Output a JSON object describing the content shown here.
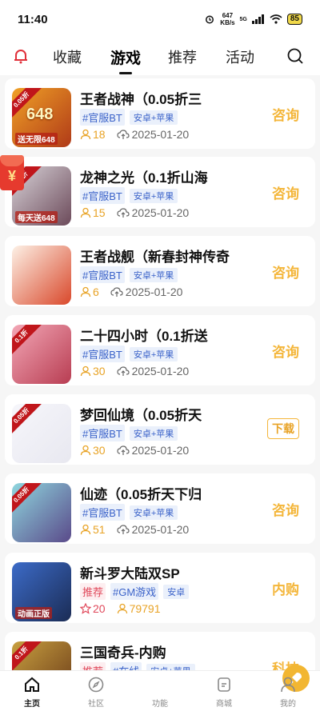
{
  "status": {
    "time": "11:40",
    "speed_top": "647",
    "speed_bottom": "KB/s",
    "net": "5G",
    "battery": "85"
  },
  "nav": {
    "tabs": [
      "收藏",
      "游戏",
      "推荐",
      "活动"
    ],
    "active": "游戏"
  },
  "games": [
    {
      "title": "王者战神（0.05折三",
      "tag": "#官服BT",
      "platform": "安卓+苹果",
      "count": "18",
      "date": "2025-01-20",
      "action": "咨询",
      "ribbon": "0.05折",
      "art": "648",
      "art_sub": "送无限648",
      "colors": [
        "#f0a126",
        "#b03a18"
      ]
    },
    {
      "title": "龙神之光（0.1折山海",
      "tag": "#官服BT",
      "platform": "安卓+苹果",
      "count": "15",
      "date": "2025-01-20",
      "action": "咨询",
      "ribbon": "0.1折",
      "art": "",
      "art_sub": "每天送648",
      "colors": [
        "#d9d4d9",
        "#6c4a5a"
      ]
    },
    {
      "title": "王者战舰（新春封神传奇",
      "tag": "#官服BT",
      "platform": "安卓+苹果",
      "count": "6",
      "date": "2025-01-20",
      "action": "咨询",
      "ribbon": "",
      "art": "",
      "art_sub": "",
      "colors": [
        "#fdf1e6",
        "#d9482b"
      ]
    },
    {
      "title": "二十四小时（0.1折送",
      "tag": "#官服BT",
      "platform": "安卓+苹果",
      "count": "30",
      "date": "2025-01-20",
      "action": "咨询",
      "ribbon": "0.1折",
      "art": "",
      "art_sub": "",
      "colors": [
        "#f3a7b6",
        "#b83d52"
      ]
    },
    {
      "title": "梦回仙境（0.05折天",
      "tag": "#官服BT",
      "platform": "安卓+苹果",
      "count": "30",
      "date": "2025-01-20",
      "action": "下载",
      "ribbon": "0.05折",
      "art": "",
      "art_sub": "",
      "colors": [
        "#f6f6fb",
        "#e8e8f0"
      ]
    },
    {
      "title": "仙迹（0.05折天下归",
      "tag": "#官服BT",
      "platform": "安卓+苹果",
      "count": "51",
      "date": "2025-01-20",
      "action": "咨询",
      "ribbon": "0.05折",
      "art": "",
      "art_sub": "",
      "colors": [
        "#8fd6de",
        "#5a4a8a"
      ]
    },
    {
      "title": "新斗罗大陆双SP",
      "tag_red": "推荐",
      "tag": "#GM游戏",
      "platform": "安卓",
      "stars": "20",
      "count": "79791",
      "action": "内购",
      "ribbon": "",
      "art": "",
      "art_sub": "动画正版",
      "colors": [
        "#3c6bc8",
        "#1b2c55"
      ]
    },
    {
      "title": "三国奇兵-内购",
      "tag_red": "推荐",
      "tag": "#在线",
      "platform": "安卓+苹果",
      "action": "科技",
      "ribbon": "0.1折",
      "art": "",
      "art_sub": "",
      "colors": [
        "#c8a040",
        "#6a3a18"
      ]
    }
  ],
  "bottom": {
    "items": [
      "主页",
      "社区",
      "功能",
      "商城",
      "我的"
    ]
  }
}
